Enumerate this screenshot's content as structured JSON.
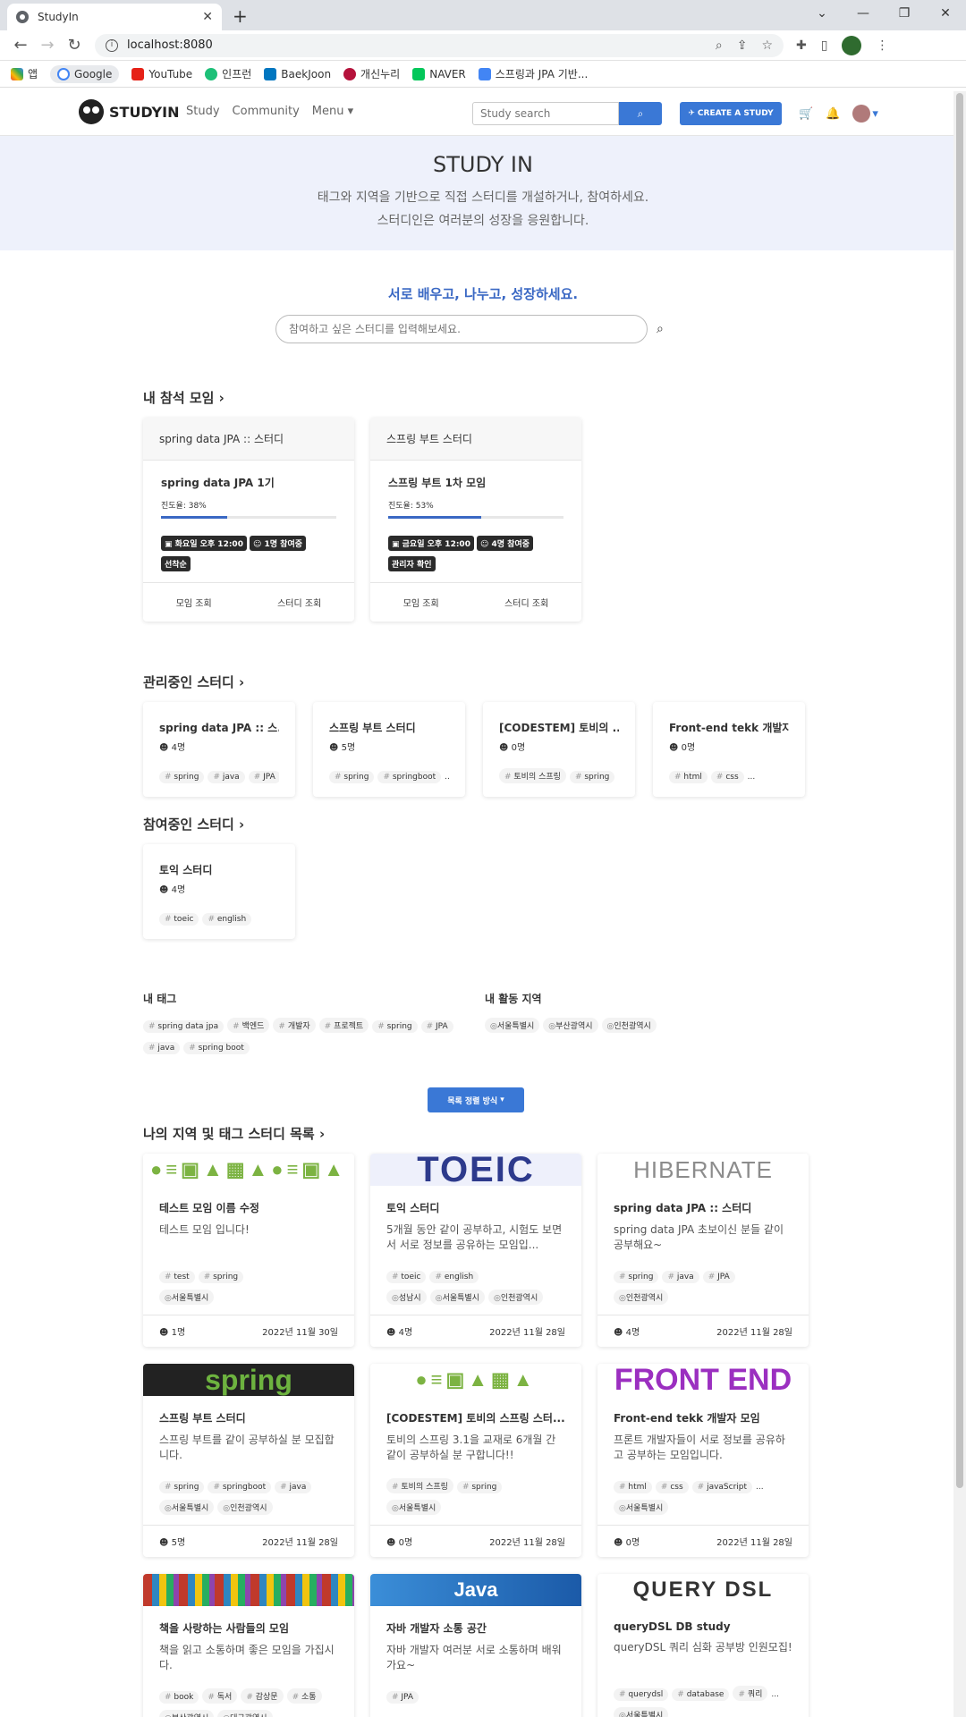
{
  "browser": {
    "tab_title": "StudyIn",
    "url": "localhost:8080",
    "bookmarks": [
      "앱",
      "Google",
      "YouTube",
      "인프런",
      "BaekJoon",
      "개신누리",
      "NAVER",
      "스프링과 JPA 기반..."
    ]
  },
  "nav": {
    "brand": "STUDYIN",
    "links": [
      "Study",
      "Community",
      "Menu"
    ],
    "search_placeholder": "Study search",
    "create_label": "CREATE A STUDY"
  },
  "hero": {
    "title": "STUDY IN",
    "line1": "태그와 지역을 기반으로 직접 스터디를 개설하거나, 참여하세요.",
    "line2": "스터디인은 여러분의 성장을 응원합니다."
  },
  "tagline": "서로 배우고, 나누고, 성장하세요.",
  "main_search_placeholder": "참여하고 싶은 스터디를 입력해보세요.",
  "my_meetings": {
    "title": "내 참석 모임",
    "cards": [
      {
        "study": "spring data JPA :: 스터디",
        "meeting": "spring data JPA 1기",
        "progress_label": "진도율: 38%",
        "progress": 0.38,
        "badges": [
          "화요일 오후 12:00",
          "1명 참여중",
          "선착순"
        ],
        "btn1": "모임 조회",
        "btn2": "스터디 조회"
      },
      {
        "study": "스프링 부트 스터디",
        "meeting": "스프링 부트 1차 모임",
        "progress_label": "진도율: 53%",
        "progress": 0.53,
        "badges": [
          "금요일 오후 12:00",
          "4명 참여중",
          "관리자 확인"
        ],
        "btn1": "모임 조회",
        "btn2": "스터디 조회"
      }
    ]
  },
  "managing": {
    "title": "관리중인 스터디",
    "cards": [
      {
        "title": "spring data JPA :: 스...",
        "members": "4명",
        "tags": [
          "spring",
          "java",
          "JPA"
        ]
      },
      {
        "title": "스프링 부트 스터디",
        "members": "5명",
        "tags": [
          "spring",
          "springboot",
          "..."
        ]
      },
      {
        "title": "[CODESTEM] 토비의 ...",
        "members": "0명",
        "tags": [
          "토비의 스프링",
          "spring"
        ]
      },
      {
        "title": "Front-end tekk 개발자...",
        "members": "0명",
        "tags": [
          "html",
          "css",
          "..."
        ]
      }
    ]
  },
  "joined": {
    "title": "참여중인 스터디",
    "cards": [
      {
        "title": "토익 스터디",
        "members": "4명",
        "tags": [
          "toeic",
          "english"
        ]
      }
    ]
  },
  "my_tags": {
    "title": "내 태그",
    "tags": [
      "spring data jpa",
      "백엔드",
      "개발자",
      "프로젝트",
      "spring",
      "JPA",
      "java",
      "spring boot"
    ]
  },
  "my_zones": {
    "title": "내 활동 지역",
    "zones": [
      "서울특별시",
      "부산광역시",
      "인천광역시"
    ]
  },
  "sort_label": "목록 정렬 방식",
  "study_list": {
    "title": "나의 지역 및 태그 스터디 목록",
    "cards": [
      {
        "banner": "●≡▣▲▦▲●≡▣▲",
        "title": "테스트 모임 이름 수정",
        "desc": "테스트 모임 입니다!",
        "tags": [
          "test",
          "spring"
        ],
        "zones": [
          "서울특별시"
        ],
        "members": "1명",
        "date": "2022년 11월 30일"
      },
      {
        "banner": "TOEIC",
        "title": "토익 스터디",
        "desc": "5개월 동안 같이 공부하고, 시험도 보면서 서로 정보를 공유하는 모임입...",
        "tags": [
          "toeic",
          "english"
        ],
        "zones": [
          "성남시",
          "서울특별시",
          "인천광역시"
        ],
        "members": "4명",
        "date": "2022년 11월 28일"
      },
      {
        "banner": "HIBERNATE",
        "title": "spring data JPA :: 스터디",
        "desc": "spring data JPA 초보이신 분들 같이 공부해요~",
        "tags": [
          "spring",
          "java",
          "JPA"
        ],
        "zones": [
          "인천광역시"
        ],
        "members": "4명",
        "date": "2022년 11월 28일"
      },
      {
        "banner": "spring",
        "title": "스프링 부트 스터디",
        "desc": "스프링 부트를 같이 공부하실 분 모집합니다.",
        "tags": [
          "spring",
          "springboot",
          "java"
        ],
        "zones": [
          "서울특별시",
          "인천광역시"
        ],
        "members": "5명",
        "date": "2022년 11월 28일"
      },
      {
        "banner": "●≡▣▲▦▲",
        "title": "[CODESTEM] 토비의 스프링 스터...",
        "desc": "토비의 스프링 3.1을 교재로 6개월 간 같이 공부하실 분 구합니다!!",
        "tags": [
          "토비의 스프링",
          "spring"
        ],
        "zones": [
          "서울특별시"
        ],
        "members": "0명",
        "date": "2022년 11월 28일"
      },
      {
        "banner": "FRONT END",
        "title": "Front-end tekk 개발자 모임",
        "desc": "프론트 개발자들이 서로 정보를 공유하고 공부하는 모임입니다.",
        "tags": [
          "html",
          "css",
          "javaScript",
          "..."
        ],
        "zones": [
          "서울특별시"
        ],
        "members": "0명",
        "date": "2022년 11월 28일"
      },
      {
        "banner": "",
        "title": "책을 사랑하는 사람들의 모임",
        "desc": "책을 읽고 소통하며 좋은 모임을 가집시다.",
        "tags": [
          "book",
          "독서",
          "감상문",
          "소통"
        ],
        "zones": [
          "부산광역시",
          "대구광역시"
        ],
        "members": "",
        "date": ""
      },
      {
        "banner": "Java",
        "title": "자바 개발자 소통 공간",
        "desc": "자바 개발자 여러분 서로 소통하며 배워가요~",
        "tags": [
          "JPA"
        ],
        "zones": [],
        "members": "",
        "date": ""
      },
      {
        "banner": "QUERY DSL",
        "title": "queryDSL DB study",
        "desc": "queryDSL 쿼리 심화 공부방 인원모집!",
        "tags": [
          "querydsl",
          "database",
          "쿼리",
          "..."
        ],
        "zones": [
          "서울특별시"
        ],
        "members": "",
        "date": ""
      }
    ]
  },
  "colors": {
    "accent": "#3a78d6",
    "hero_bg": "#eef1fb",
    "tagline": "#3a68c4"
  }
}
